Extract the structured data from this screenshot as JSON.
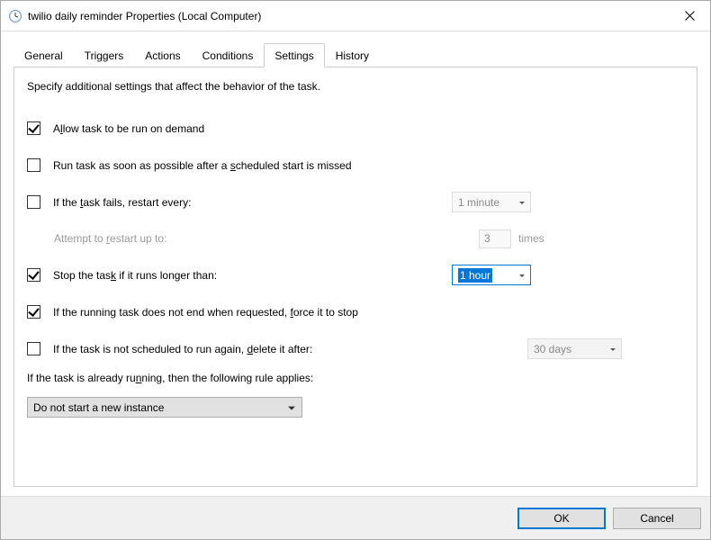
{
  "window": {
    "title": "twilio daily reminder Properties (Local Computer)"
  },
  "tabs": {
    "general": "General",
    "triggers": "Triggers",
    "actions": "Actions",
    "conditions": "Conditions",
    "settings": "Settings",
    "history": "History",
    "active": "settings"
  },
  "settings": {
    "intro": "Specify additional settings that affect the behavior of the task.",
    "allow_on_demand": {
      "checked": true,
      "label_pre": "A",
      "label_ul": "l",
      "label_post": "low task to be run on demand"
    },
    "run_asap": {
      "checked": false,
      "label_pre": "Run task as soon as possible after a ",
      "label_ul": "s",
      "label_post": "cheduled start is missed"
    },
    "restart_if_fails": {
      "checked": false,
      "label_pre": "If the ",
      "label_ul": "t",
      "label_post": "ask fails, restart every:",
      "interval": "1 minute"
    },
    "restart_attempts": {
      "label_pre": "Attempt to ",
      "label_ul": "r",
      "label_post": "estart up to:",
      "value": "3",
      "suffix": "times"
    },
    "stop_if_longer": {
      "checked": true,
      "label_pre": "Stop the tas",
      "label_ul": "k",
      "label_post": " if it runs longer than:",
      "duration": "1 hour"
    },
    "force_stop": {
      "checked": true,
      "label_pre": "If the running task does not end when requested, ",
      "label_ul": "f",
      "label_post": "orce it to stop"
    },
    "delete_after": {
      "checked": false,
      "label_pre": "If the task is not scheduled to run again, ",
      "label_ul": "d",
      "label_post": "elete it after:",
      "duration": "30 days"
    },
    "rule_label_pre": "If the task is already ru",
    "rule_label_ul": "n",
    "rule_label_post": "ning, then the following rule applies:",
    "rule_value": "Do not start a new instance"
  },
  "buttons": {
    "ok": "OK",
    "cancel": "Cancel"
  }
}
